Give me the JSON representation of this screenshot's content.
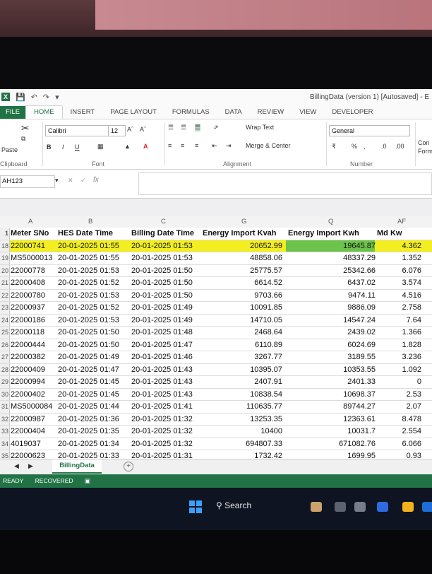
{
  "window": {
    "title": "BillingData (version 1) [Autosaved] - E"
  },
  "ribbon_tabs": [
    "FILE",
    "HOME",
    "INSERT",
    "PAGE LAYOUT",
    "FORMULAS",
    "DATA",
    "REVIEW",
    "VIEW",
    "DEVELOPER"
  ],
  "ribbon": {
    "paste_label": "Paste",
    "clipboard_label": "Clipboard",
    "font_name": "Calibri",
    "font_size": "12",
    "font_label": "Font",
    "wrap_text": "Wrap Text",
    "merge_center": "Merge & Center",
    "alignment_label": "Alignment",
    "number_format": "General",
    "number_label": "Number",
    "conditional": "Con",
    "format_as": "Form"
  },
  "formula_bar": {
    "name_box": "AH123",
    "fx": "fx",
    "value": ""
  },
  "column_letters": [
    "A",
    "B",
    "C",
    "G",
    "Q",
    "AF"
  ],
  "header_row": {
    "row_num": "1",
    "a": "Meter SNo",
    "b": "HES Date Time",
    "c": "Billing Date Time",
    "g": "Energy Import Kvah",
    "q": "Energy Import Kwh",
    "af": "Md Kw"
  },
  "rows": [
    {
      "n": "18",
      "a": "22000741",
      "b": "20-01-2025 01:55",
      "c": "20-01-2025 01:53",
      "g": "20652.99",
      "q": "19645.87",
      "af": "4.362"
    },
    {
      "n": "19",
      "a": "MS5000013",
      "b": "20-01-2025 01:55",
      "c": "20-01-2025 01:53",
      "g": "48858.06",
      "q": "48337.29",
      "af": "1.352"
    },
    {
      "n": "20",
      "a": "22000778",
      "b": "20-01-2025 01:53",
      "c": "20-01-2025 01:50",
      "g": "25775.57",
      "q": "25342.66",
      "af": "6.076"
    },
    {
      "n": "21",
      "a": "22000408",
      "b": "20-01-2025 01:52",
      "c": "20-01-2025 01:50",
      "g": "6614.52",
      "q": "6437.02",
      "af": "3.574"
    },
    {
      "n": "22",
      "a": "22000780",
      "b": "20-01-2025 01:53",
      "c": "20-01-2025 01:50",
      "g": "9703.66",
      "q": "9474.11",
      "af": "4.516"
    },
    {
      "n": "23",
      "a": "22000937",
      "b": "20-01-2025 01:52",
      "c": "20-01-2025 01:49",
      "g": "10091.85",
      "q": "9886.09",
      "af": "2.758"
    },
    {
      "n": "24",
      "a": "22000186",
      "b": "20-01-2025 01:53",
      "c": "20-01-2025 01:49",
      "g": "14710.05",
      "q": "14547.24",
      "af": "7.64"
    },
    {
      "n": "25",
      "a": "22000118",
      "b": "20-01-2025 01:50",
      "c": "20-01-2025 01:48",
      "g": "2468.64",
      "q": "2439.02",
      "af": "1.366"
    },
    {
      "n": "26",
      "a": "22000444",
      "b": "20-01-2025 01:50",
      "c": "20-01-2025 01:47",
      "g": "6110.89",
      "q": "6024.69",
      "af": "1.828"
    },
    {
      "n": "27",
      "a": "22000382",
      "b": "20-01-2025 01:49",
      "c": "20-01-2025 01:46",
      "g": "3267.77",
      "q": "3189.55",
      "af": "3.236"
    },
    {
      "n": "28",
      "a": "22000409",
      "b": "20-01-2025 01:47",
      "c": "20-01-2025 01:43",
      "g": "10395.07",
      "q": "10353.55",
      "af": "1.092"
    },
    {
      "n": "29",
      "a": "22000994",
      "b": "20-01-2025 01:45",
      "c": "20-01-2025 01:43",
      "g": "2407.91",
      "q": "2401.33",
      "af": "0"
    },
    {
      "n": "30",
      "a": "22000402",
      "b": "20-01-2025 01:45",
      "c": "20-01-2025 01:43",
      "g": "10838.54",
      "q": "10698.37",
      "af": "2.53"
    },
    {
      "n": "31",
      "a": "MS5000084",
      "b": "20-01-2025 01:44",
      "c": "20-01-2025 01:41",
      "g": "110635.77",
      "q": "89744.27",
      "af": "2.07"
    },
    {
      "n": "32",
      "a": "22000987",
      "b": "20-01-2025 01:36",
      "c": "20-01-2025 01:32",
      "g": "13253.35",
      "q": "12363.61",
      "af": "8.478"
    },
    {
      "n": "33",
      "a": "22000404",
      "b": "20-01-2025 01:35",
      "c": "20-01-2025 01:32",
      "g": "10400",
      "q": "10031.7",
      "af": "2.554"
    },
    {
      "n": "34",
      "a": "4019037",
      "b": "20-01-2025 01:34",
      "c": "20-01-2025 01:32",
      "g": "694807.33",
      "q": "671082.76",
      "af": "6.066"
    },
    {
      "n": "35",
      "a": "22000623",
      "b": "20-01-2025 01:33",
      "c": "20-01-2025 01:31",
      "g": "1732.42",
      "q": "1699.95",
      "af": "0.93"
    }
  ],
  "sheet_tab": "BillingData",
  "status": {
    "ready": "READY",
    "recovered": "RECOVERED"
  },
  "taskbar": {
    "search": "Search"
  },
  "colors": {
    "excel_green": "#217346",
    "highlight_yellow": "#f2ee22",
    "selection_green": "#6cc24a"
  }
}
